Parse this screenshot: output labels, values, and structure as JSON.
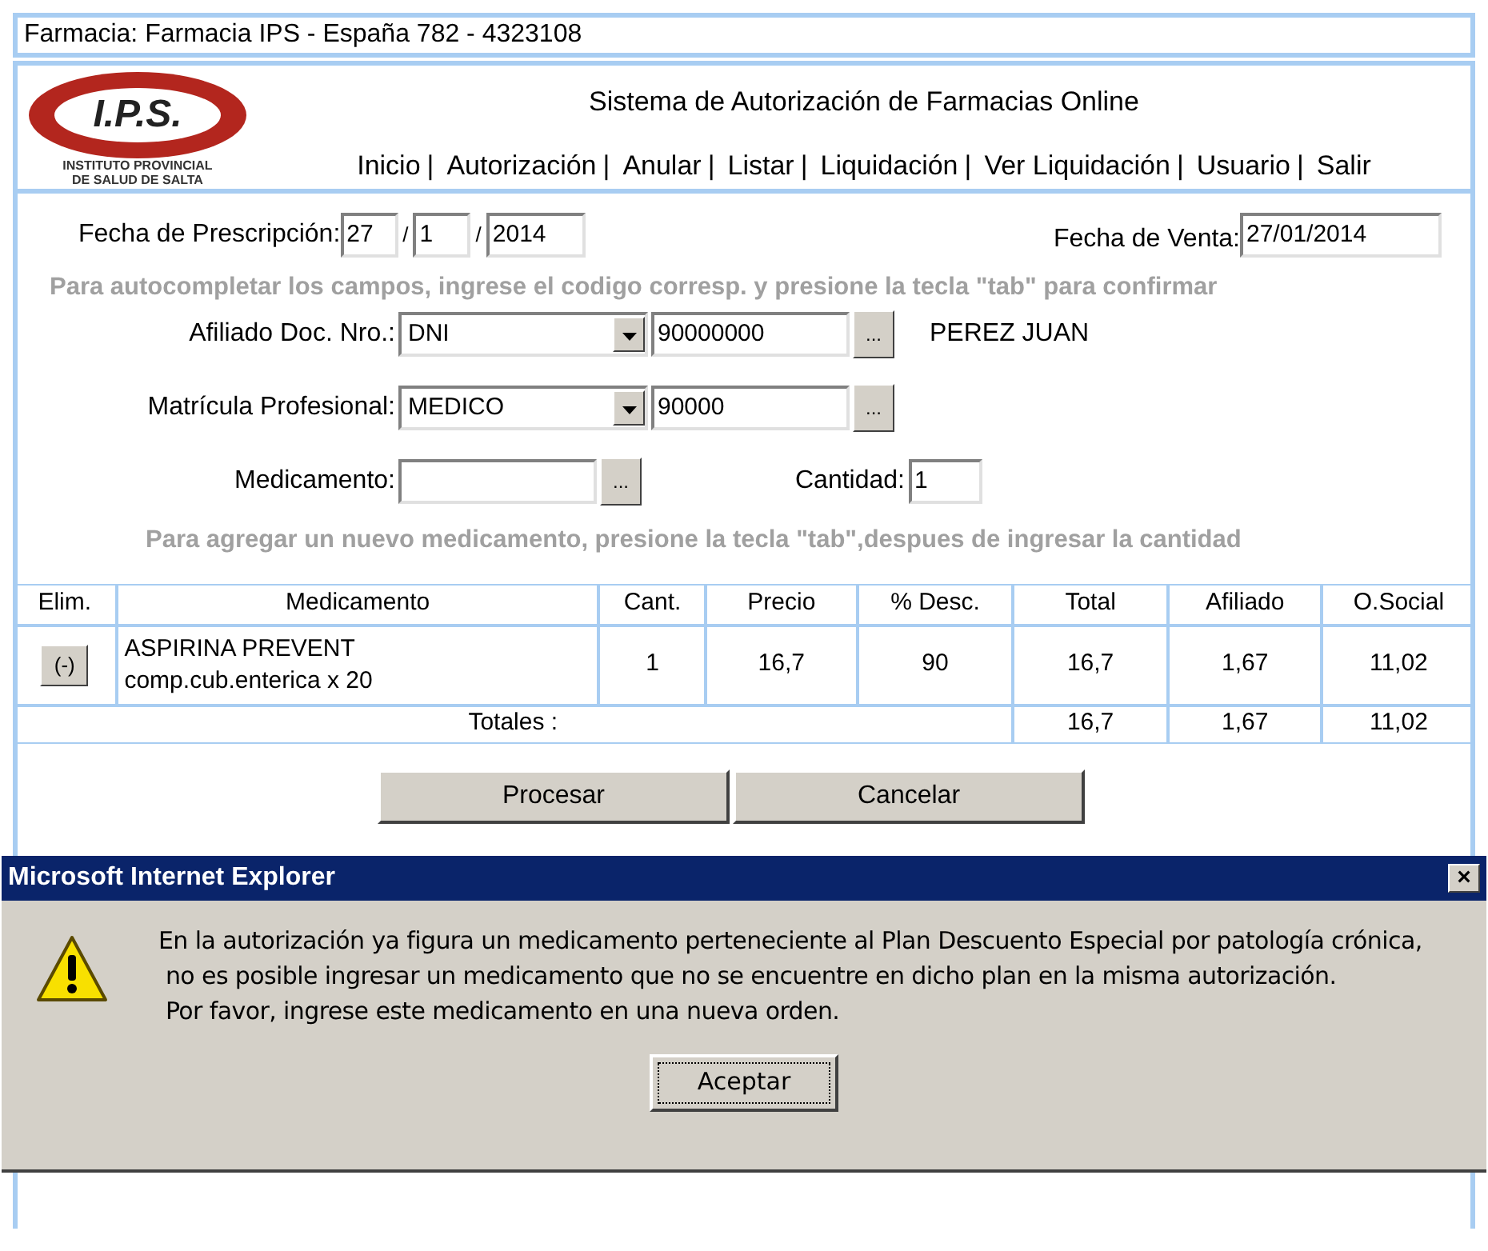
{
  "pharmacy_bar": {
    "text": "Farmacia: Farmacia IPS - España 782 - 4323108"
  },
  "logo": {
    "mark": "I.P.S.",
    "caption_lines": [
      "INSTITUTO PROVINCIAL",
      "DE SALUD DE SALTA"
    ]
  },
  "header": {
    "title": "Sistema de Autorización de Farmacias Online"
  },
  "menu": [
    {
      "label": "Inicio",
      "separator": "|"
    },
    {
      "label": "Autorización",
      "separator": "|"
    },
    {
      "label": "Anular",
      "separator": "|"
    },
    {
      "label": "Listar",
      "separator": "|"
    },
    {
      "label": "Liquidación",
      "separator": "|"
    },
    {
      "label": "Ver Liquidación",
      "separator": "|"
    },
    {
      "label": "Usuario",
      "separator": "|"
    },
    {
      "label": "Salir"
    }
  ],
  "form": {
    "prescription_date": {
      "label": "Fecha de Prescripción:",
      "day": "27",
      "sep1": "/",
      "month": "1",
      "sep2": "/",
      "year": "2014"
    },
    "sale_date": {
      "label": "Fecha de Venta:",
      "value": "27/01/2014"
    },
    "hint_autocomplete": "Para autocompletar los campos, ingrese el codigo corresp. y presione la tecla \"tab\" para confirmar",
    "affiliate": {
      "label": "Afiliado Doc. Nro.:",
      "type": "DNI",
      "number": "90000000",
      "lookup": "...",
      "name": "PEREZ JUAN"
    },
    "license": {
      "label": "Matrícula Profesional:",
      "type": "MEDICO",
      "number": "90000",
      "lookup": "..."
    },
    "medication": {
      "label": "Medicamento:",
      "lookup": "..."
    },
    "quantity": {
      "label": "Cantidad:",
      "value": "1"
    },
    "hint_add": "Para agregar un nuevo medicamento, presione la tecla \"tab\",despues de ingresar la cantidad"
  },
  "table": {
    "columns": [
      "Elim.",
      "Medicamento",
      "Cant.",
      "Precio",
      "% Desc.",
      "Total",
      "Afiliado",
      "O.Social"
    ],
    "rows": [
      {
        "remove": "(-)",
        "medication_lines": [
          "ASPIRINA PREVENT",
          "comp.cub.enterica x 20"
        ],
        "quantity": "1",
        "price": "16,7",
        "discount": "90",
        "total": "16,7",
        "affiliate": "1,67",
        "social": "11,02"
      }
    ],
    "totals": {
      "label": "Totales :",
      "total": "16,7",
      "affiliate": "1,67",
      "social": "11,02"
    }
  },
  "buttons": [
    "Procesar",
    "Cancelar"
  ],
  "dialog": {
    "title": "Microsoft Internet Explorer",
    "close": "×",
    "message_lines": [
      "En la autorización ya figura un medicamento perteneciente al Plan Descuento Especial por patología crónica,",
      " no es posible ingresar un medicamento que no se encuentre en dicho plan en la misma autorización.",
      " Por favor, ingrese este medicamento en una nueva orden."
    ],
    "button": "Aceptar"
  }
}
